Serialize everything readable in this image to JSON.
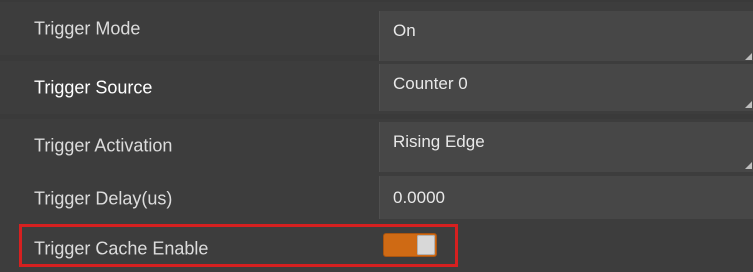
{
  "rows": [
    {
      "label": "Trigger Mode",
      "value": "On",
      "type": "dropdown"
    },
    {
      "label": "Trigger Source",
      "value": "Counter 0",
      "type": "dropdown"
    },
    {
      "label": "Trigger Activation",
      "value": "Rising Edge",
      "type": "dropdown"
    },
    {
      "label": "Trigger Delay(us)",
      "value": "0.0000",
      "type": "number"
    },
    {
      "label": "Trigger Cache Enable",
      "value": "On",
      "type": "toggle"
    }
  ],
  "colors": {
    "background": "#3a3a3a",
    "highlight": "#d62020",
    "toggle_on": "#cf6a14"
  }
}
